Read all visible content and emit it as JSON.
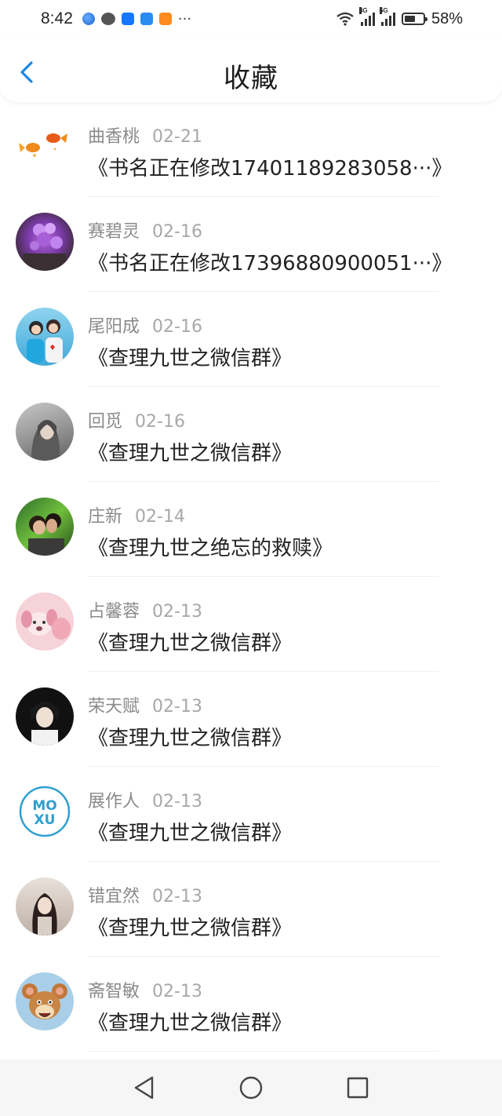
{
  "status": {
    "time": "8:42",
    "battery": "58%",
    "net1": "4G",
    "net2": "5G",
    "battery_level": 0.58
  },
  "header": {
    "title": "收藏"
  },
  "colors": {
    "accent": "#1e88e5"
  },
  "items": [
    {
      "name": "曲香桃",
      "date": "02-21",
      "book": "《书名正在修改17401189283058···》",
      "avatar": "goldfish"
    },
    {
      "name": "赛碧灵",
      "date": "02-16",
      "book": "《书名正在修改17396880900051···》",
      "avatar": "purple-balloons"
    },
    {
      "name": "尾阳成",
      "date": "02-16",
      "book": "《查理九世之微信群》",
      "avatar": "couple-photo"
    },
    {
      "name": "回觅",
      "date": "02-16",
      "book": "《查理九世之微信群》",
      "avatar": "girl-portrait"
    },
    {
      "name": "庄新",
      "date": "02-14",
      "book": "《查理九世之绝忘的救赎》",
      "avatar": "couple-kiss"
    },
    {
      "name": "占馨蓉",
      "date": "02-13",
      "book": "《查理九世之微信群》",
      "avatar": "pink-puppy"
    },
    {
      "name": "荣天赋",
      "date": "02-13",
      "book": "《查理九世之微信群》",
      "avatar": "boy-portrait"
    },
    {
      "name": "展作人",
      "date": "02-13",
      "book": "《查理九世之微信群》",
      "avatar": "moxu-logo",
      "logo_text": [
        "MO",
        "XU"
      ]
    },
    {
      "name": "错宜然",
      "date": "02-13",
      "book": "《查理九世之微信群》",
      "avatar": "woman-portrait"
    },
    {
      "name": "斋智敏",
      "date": "02-13",
      "book": "《查理九世之微信群》",
      "avatar": "jerry-mouse"
    }
  ],
  "nav": [
    "back-triangle",
    "home-circle",
    "recent-square"
  ]
}
